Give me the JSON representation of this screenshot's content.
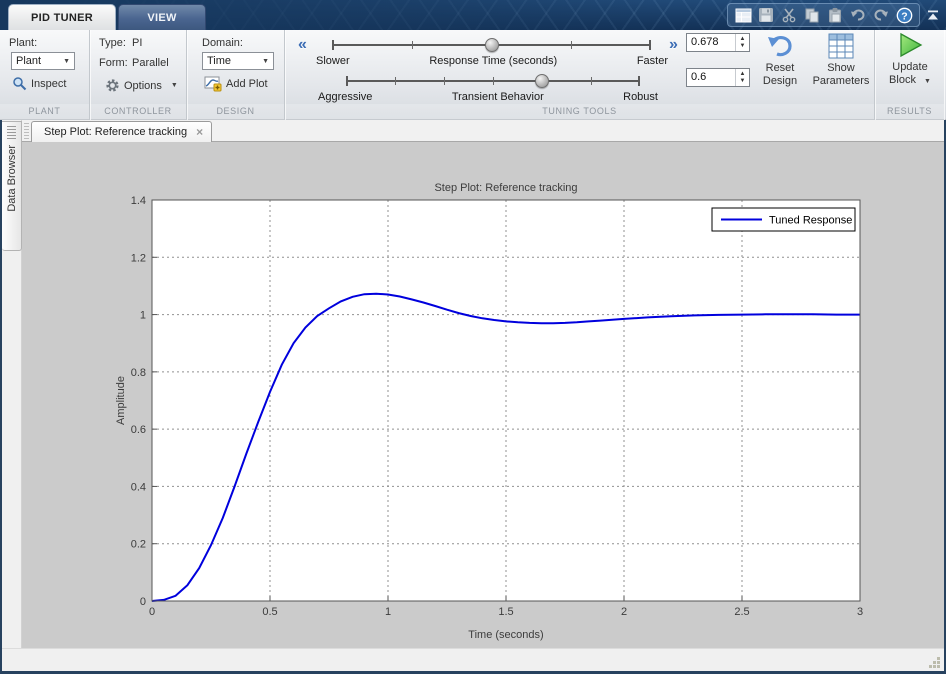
{
  "titlebar": {
    "tabs": [
      {
        "label": "PID TUNER",
        "active": true
      },
      {
        "label": "VIEW",
        "active": false
      }
    ],
    "quick_access_icons": [
      "layout",
      "save",
      "cut",
      "copy",
      "paste",
      "undo",
      "redo",
      "help"
    ],
    "collapse_icon": "collapse-ribbon"
  },
  "ribbon": {
    "plant": {
      "label": "PLANT",
      "field_label": "Plant:",
      "dropdown_value": "Plant",
      "inspect": "Inspect"
    },
    "controller": {
      "label": "CONTROLLER",
      "type_label": "Type:",
      "type_value": "PI",
      "form_label": "Form:",
      "form_value": "Parallel",
      "options": "Options"
    },
    "design": {
      "label": "DESIGN",
      "domain_label": "Domain:",
      "domain_value": "Time",
      "add_plot": "Add Plot"
    },
    "tuning": {
      "label": "TUNING TOOLS",
      "response_slider": {
        "left": "Slower",
        "title": "Response Time (seconds)",
        "right": "Faster",
        "pos": 0.5,
        "ticks": [
          0.25,
          0.75
        ]
      },
      "behavior_slider": {
        "left": "Aggressive",
        "title": "Transient Behavior",
        "right": "Robust",
        "pos": 0.667,
        "ticks": [
          0.1667,
          0.3333,
          0.5,
          0.8333
        ]
      },
      "response_value": "0.678",
      "behavior_value": "0.6",
      "reset_line1": "Reset",
      "reset_line2": "Design",
      "show_line1": "Show",
      "show_line2": "Parameters"
    },
    "results": {
      "label": "RESULTS",
      "update_line1": "Update",
      "update_line2": "Block"
    }
  },
  "data_browser_label": "Data Browser",
  "doc_tab": {
    "label": "Step Plot: Reference tracking",
    "close": "×"
  },
  "chart_data": {
    "type": "line",
    "title": "Step Plot: Reference tracking",
    "xlabel": "Time (seconds)",
    "ylabel": "Amplitude",
    "xlim": [
      0,
      3
    ],
    "ylim": [
      0,
      1.4
    ],
    "xticks": [
      0,
      0.5,
      1,
      1.5,
      2,
      2.5,
      3
    ],
    "yticks": [
      0,
      0.2,
      0.4,
      0.6,
      0.8,
      1,
      1.2,
      1.4
    ],
    "grid": "dashed",
    "legend": {
      "position": "top-right",
      "entries": [
        {
          "label": "Tuned Response",
          "color": "#0000dd"
        }
      ]
    },
    "series": [
      {
        "name": "Tuned Response",
        "color": "#0000dd",
        "points": [
          [
            0,
            0
          ],
          [
            0.05,
            0.004
          ],
          [
            0.1,
            0.018
          ],
          [
            0.15,
            0.055
          ],
          [
            0.2,
            0.115
          ],
          [
            0.25,
            0.195
          ],
          [
            0.3,
            0.29
          ],
          [
            0.35,
            0.4
          ],
          [
            0.4,
            0.515
          ],
          [
            0.45,
            0.625
          ],
          [
            0.5,
            0.73
          ],
          [
            0.55,
            0.825
          ],
          [
            0.6,
            0.9
          ],
          [
            0.65,
            0.955
          ],
          [
            0.7,
            0.995
          ],
          [
            0.75,
            1.022
          ],
          [
            0.8,
            1.046
          ],
          [
            0.85,
            1.062
          ],
          [
            0.9,
            1.071
          ],
          [
            0.95,
            1.073
          ],
          [
            1.0,
            1.07
          ],
          [
            1.05,
            1.063
          ],
          [
            1.1,
            1.053
          ],
          [
            1.15,
            1.042
          ],
          [
            1.2,
            1.03
          ],
          [
            1.25,
            1.017
          ],
          [
            1.3,
            1.005
          ],
          [
            1.35,
            0.995
          ],
          [
            1.4,
            0.987
          ],
          [
            1.45,
            0.981
          ],
          [
            1.5,
            0.976
          ],
          [
            1.55,
            0.973
          ],
          [
            1.6,
            0.971
          ],
          [
            1.65,
            0.97
          ],
          [
            1.7,
            0.97
          ],
          [
            1.75,
            0.971
          ],
          [
            1.8,
            0.973
          ],
          [
            1.85,
            0.976
          ],
          [
            1.9,
            0.979
          ],
          [
            1.95,
            0.982
          ],
          [
            2.0,
            0.985
          ],
          [
            2.1,
            0.99
          ],
          [
            2.2,
            0.994
          ],
          [
            2.3,
            0.997
          ],
          [
            2.4,
            0.999
          ],
          [
            2.5,
            1.0
          ],
          [
            2.6,
            1.001
          ],
          [
            2.7,
            1.001
          ],
          [
            2.8,
            1.001
          ],
          [
            2.9,
            1.0
          ],
          [
            3.0,
            1.0
          ]
        ]
      }
    ]
  }
}
